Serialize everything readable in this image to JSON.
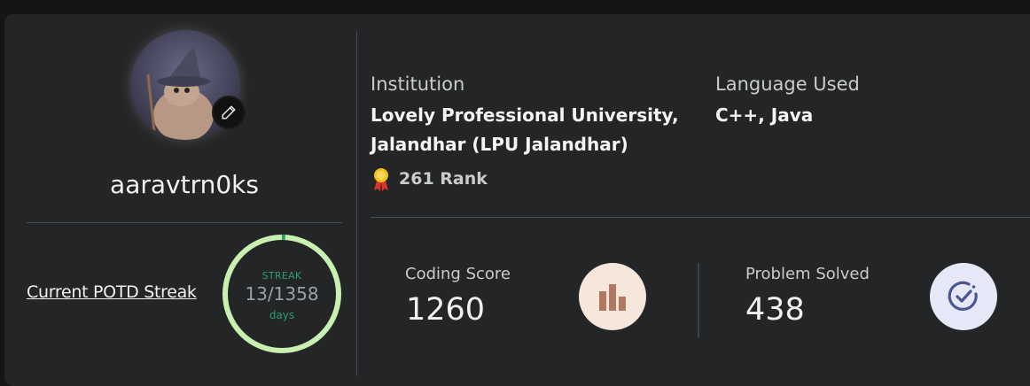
{
  "profile": {
    "username": "aaravtrn0ks",
    "avatar_icon": "wizard-cat-avatar",
    "edit_icon": "pencil-icon"
  },
  "streak": {
    "link_label": "Current POTD Streak",
    "tag": "STREAK",
    "count": "13/1358",
    "unit": "days",
    "progress": 0.0096,
    "ring_color": "#c8f0b0",
    "progress_color": "#2f9e6f"
  },
  "institution": {
    "label": "Institution",
    "line1": "Lovely Professional University,",
    "line2": "Jalandhar (LPU Jalandhar)",
    "rank_icon": "medal-icon",
    "rank": "261 Rank"
  },
  "language": {
    "label": "Language Used",
    "value": "C++, Java"
  },
  "stats": {
    "coding_score_label": "Coding Score",
    "coding_score": "1260",
    "coding_icon": "bar-chart-icon",
    "problems_label": "Problem Solved",
    "problems": "438",
    "problems_icon": "check-circle-icon"
  }
}
